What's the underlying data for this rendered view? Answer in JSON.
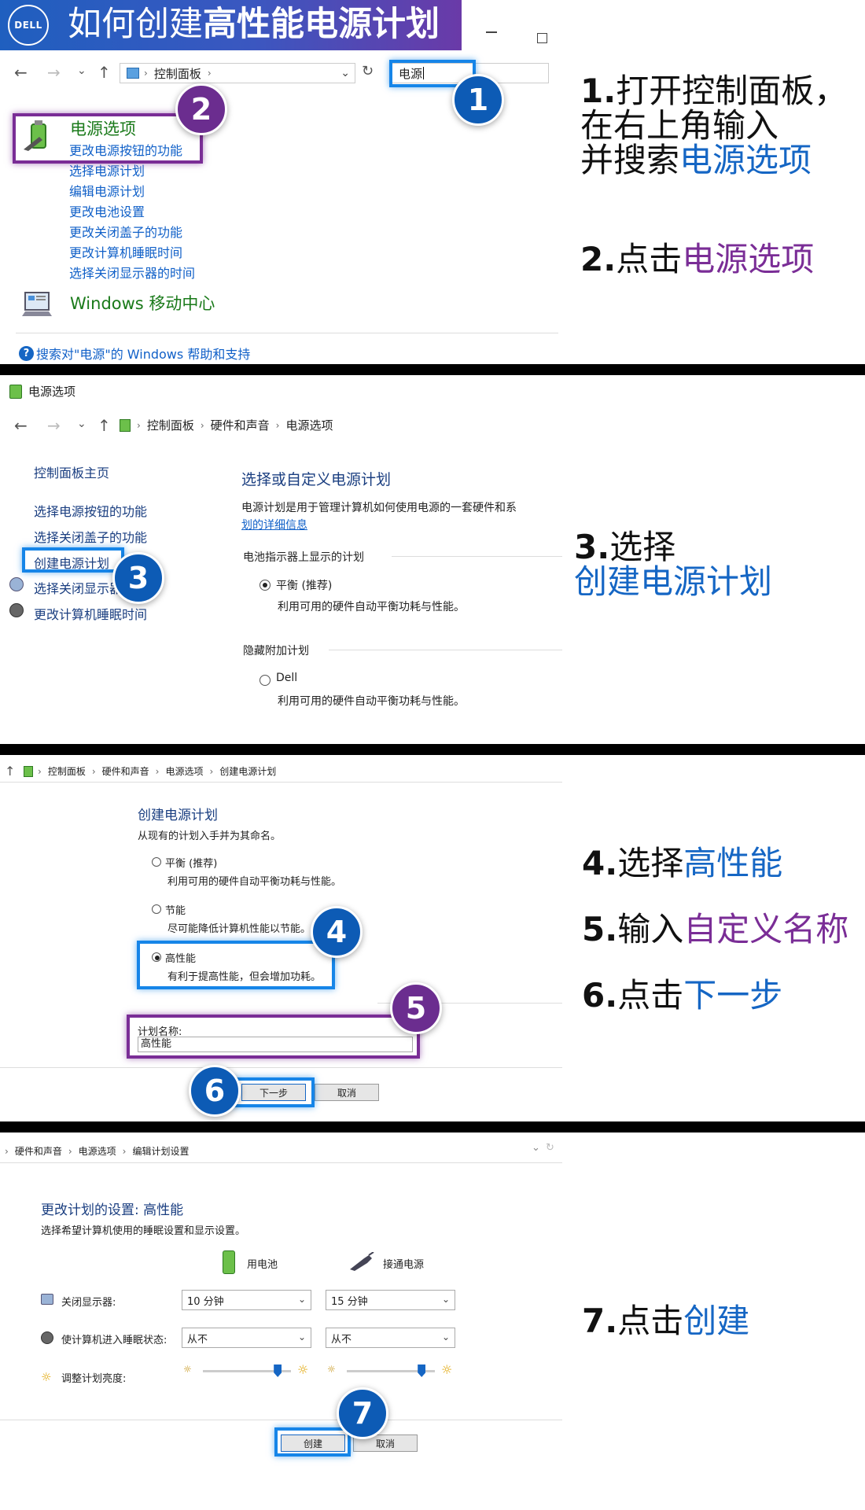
{
  "header": {
    "logo": "DELL",
    "title_part1": "如何创建",
    "title_part2": "高性能电源计划"
  },
  "step1_window": {
    "address": "控制面板",
    "search_value": "电源",
    "result_title": "电源选项",
    "links": [
      "更改电源按钮的功能",
      "选择电源计划",
      "编辑电源计划",
      "更改电池设置",
      "更改关闭盖子的功能",
      "更改计算机睡眠时间",
      "选择关闭显示器的时间"
    ],
    "mobility_title": "Windows 移动中心",
    "help_text": "搜索对\"电源\"的 Windows 帮助和支持"
  },
  "step2_window": {
    "window_title": "电源选项",
    "crumbs": [
      "控制面板",
      "硬件和声音",
      "电源选项"
    ],
    "sidebar": [
      "控制面板主页",
      "选择电源按钮的功能",
      "选择关闭盖子的功能",
      "创建电源计划",
      "选择关闭显示器",
      "更改计算机睡眠时间"
    ],
    "heading": "选择或自定义电源计划",
    "desc_line1": "电源计划是用于管理计算机如何使用电源的一套硬件和系",
    "desc_line2": "划的详细信息",
    "group1": "电池指示器上显示的计划",
    "plan1_name": "平衡 (推荐)",
    "plan1_desc": "利用可用的硬件自动平衡功耗与性能。",
    "group2": "隐藏附加计划",
    "plan2_name": "Dell",
    "plan2_desc": "利用可用的硬件自动平衡功耗与性能。"
  },
  "step3_window": {
    "crumbs": [
      "控制面板",
      "硬件和声音",
      "电源选项",
      "创建电源计划"
    ],
    "heading": "创建电源计划",
    "subheading": "从现有的计划入手并为其命名。",
    "plans": [
      {
        "name": "平衡 (推荐)",
        "desc": "利用可用的硬件自动平衡功耗与性能。"
      },
      {
        "name": "节能",
        "desc": "尽可能降低计算机性能以节能。"
      },
      {
        "name": "高性能",
        "desc": "有利于提高性能，但会增加功耗。"
      }
    ],
    "name_label": "计划名称:",
    "name_value": "高性能",
    "next_label": "下一步",
    "cancel_label": "取消"
  },
  "step4_window": {
    "crumbs": [
      "硬件和声音",
      "电源选项",
      "编辑计划设置"
    ],
    "heading": "更改计划的设置: 高性能",
    "subheading": "选择希望计算机使用的睡眠设置和显示设置。",
    "col_battery": "用电池",
    "col_plugged": "接通电源",
    "row_display": "关闭显示器:",
    "row_sleep": "使计算机进入睡眠状态:",
    "row_brightness": "调整计划亮度:",
    "display_battery": "10 分钟",
    "display_plugged": "15 分钟",
    "sleep_battery": "从不",
    "sleep_plugged": "从不",
    "brightness_battery": 0.85,
    "brightness_plugged": 0.85,
    "create_label": "创建",
    "cancel_label": "取消"
  },
  "instructions": {
    "s1_num": "1.",
    "s1_a": "打开控制面板，",
    "s1_b": "在右上角输入",
    "s1_c": "并搜索",
    "s1_hl": "电源选项",
    "s2_num": "2.",
    "s2_a": "点击",
    "s2_hl": "电源选项",
    "s3_num": "3.",
    "s3_a": "选择",
    "s3_hl": "创建电源计划",
    "s4_num": "4.",
    "s4_a": "选择",
    "s4_hl": "高性能",
    "s5_num": "5.",
    "s5_a": "输入",
    "s5_hl": "自定义名称",
    "s6_num": "6.",
    "s6_a": "点击",
    "s6_hl": "下一步",
    "s7_num": "7.",
    "s7_a": "点击",
    "s7_hl": "创建"
  },
  "badges": [
    "1",
    "2",
    "3",
    "4",
    "5",
    "6",
    "7"
  ],
  "colors": {
    "blue": "#1566c4",
    "purple": "#7a2d96",
    "highlight_blue": "#1685e8",
    "black_bar": "#000000"
  }
}
